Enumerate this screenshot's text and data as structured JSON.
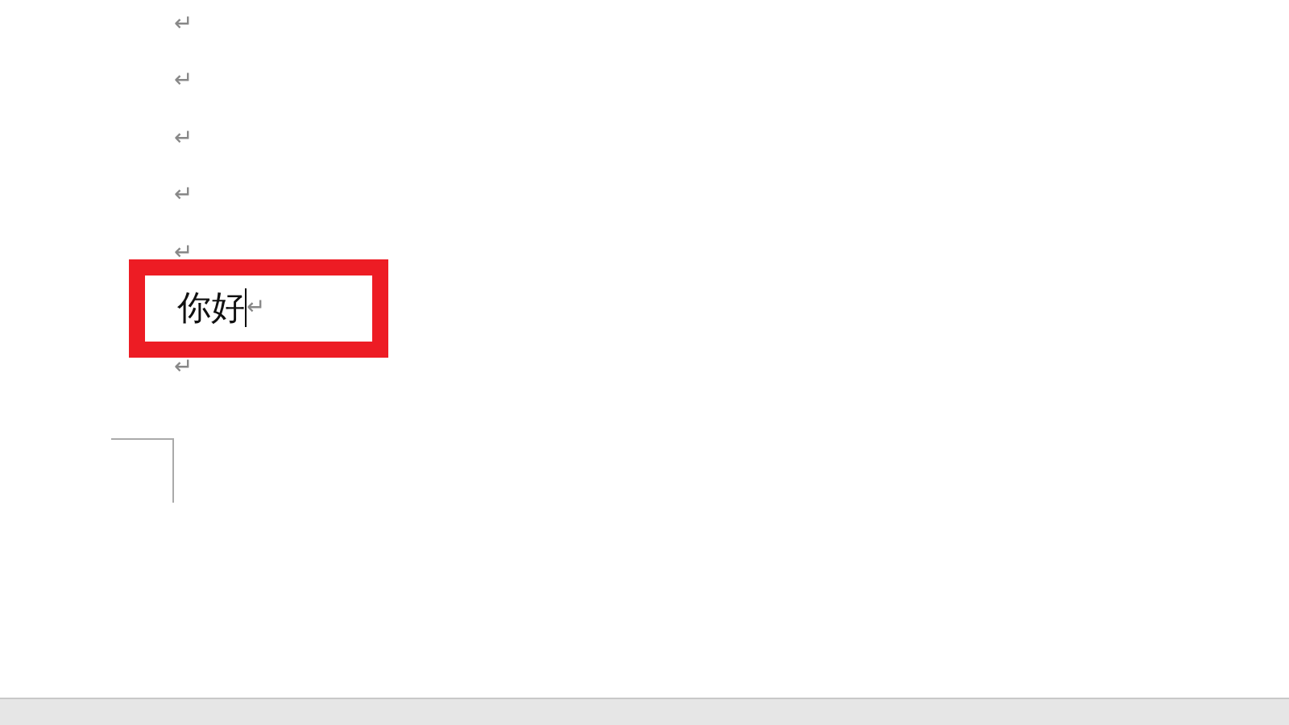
{
  "document": {
    "paragraphs": [
      {
        "mark": "↵",
        "highlighted": false,
        "cursor": false
      },
      {
        "mark": "↵",
        "highlighted": false,
        "cursor": false
      },
      {
        "mark": "↵",
        "highlighted": false,
        "cursor": false
      },
      {
        "mark": "↵",
        "highlighted": false,
        "cursor": false
      },
      {
        "mark": "↵",
        "highlighted": false,
        "cursor": false
      },
      {
        "text": "你好",
        "mark": "↵",
        "highlighted": true,
        "cursor": true
      },
      {
        "mark": "↵",
        "highlighted": false,
        "cursor": false
      }
    ]
  }
}
